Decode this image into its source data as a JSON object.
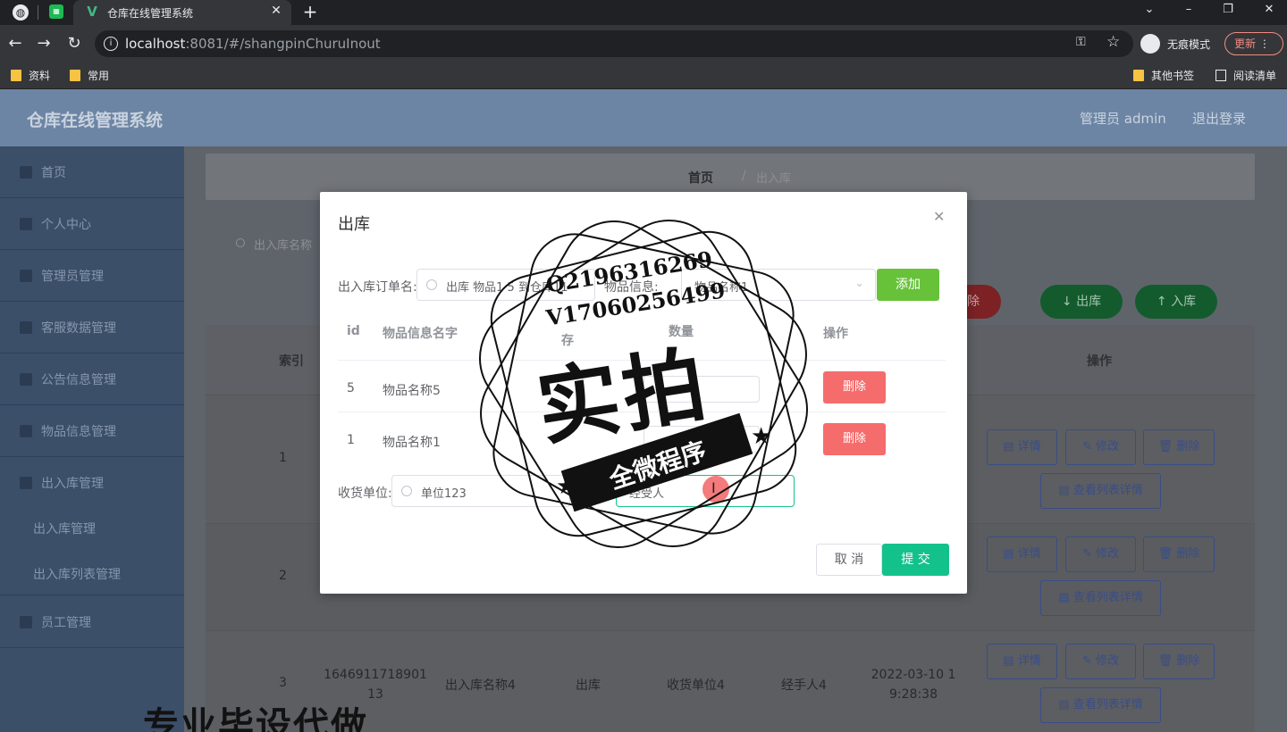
{
  "browser": {
    "tab_title": "仓库在线管理系统",
    "url_host": "localhost",
    "url_rest": ":8081/#/shangpinChuruInout",
    "incognito_label": "无痕模式",
    "update_label": "更新",
    "bookmarks": [
      "资料",
      "常用"
    ],
    "bookmarks_right": [
      "其他书签",
      "阅读清单"
    ]
  },
  "app": {
    "title": "仓库在线管理系统",
    "admin_label": "管理员 admin",
    "logout_label": "退出登录"
  },
  "sidebar": {
    "items": [
      "首页",
      "个人中心",
      "管理员管理",
      "客服数据管理",
      "公告信息管理",
      "物品信息管理",
      "出入库管理"
    ],
    "sub_items": [
      "出入库管理",
      "出入库列表管理"
    ],
    "last_item": "员工管理"
  },
  "breadcrumb": {
    "home": "首页",
    "sep": "/",
    "current": "出入库"
  },
  "toolbar": {
    "search_label": "出入库名称",
    "delete_label": "除",
    "out_label": "↓ 出库",
    "in_label": "↑ 入库"
  },
  "table": {
    "headers": {
      "index": "索引",
      "actions": "操作"
    },
    "rows": [
      {
        "index": "1"
      },
      {
        "index": "2"
      },
      {
        "index": "3",
        "order_no": "164691171890113",
        "name": "出入库名称4",
        "type": "出库",
        "unit": "收货单位4",
        "handler": "经手人4",
        "time": "2022-03-10 19:28:38"
      }
    ],
    "actions": {
      "detail": "详情",
      "edit": "修改",
      "delete": "删除",
      "list_detail": "查看列表详情"
    }
  },
  "overlay_caption": "专业毕设代做",
  "dialog": {
    "title": "出库",
    "order_label": "出入库订单名:",
    "order_value": "出库 物品1 5 到仓库11",
    "goods_label": "物品信息:",
    "goods_value": "物品名称1",
    "add_label": "添加",
    "col_id": "id",
    "col_name": "物品信息名字",
    "col_stock": "存",
    "col_qty": "数量",
    "col_action": "操作",
    "rows": [
      {
        "id": "5",
        "name": "物品名称5",
        "delete": "删除"
      },
      {
        "id": "1",
        "name": "物品名称1",
        "delete": "删除"
      }
    ],
    "receiver_label": "收货单位:",
    "receiver_value": "单位123",
    "handler_label": "经",
    "handler_value": "经受人",
    "cancel_label": "取 消",
    "submit_label": "提 交"
  },
  "watermark": {
    "line1": "Q2196316269",
    "line2": "V17060256499",
    "big": "实拍",
    "ribbon": "全微程序"
  }
}
